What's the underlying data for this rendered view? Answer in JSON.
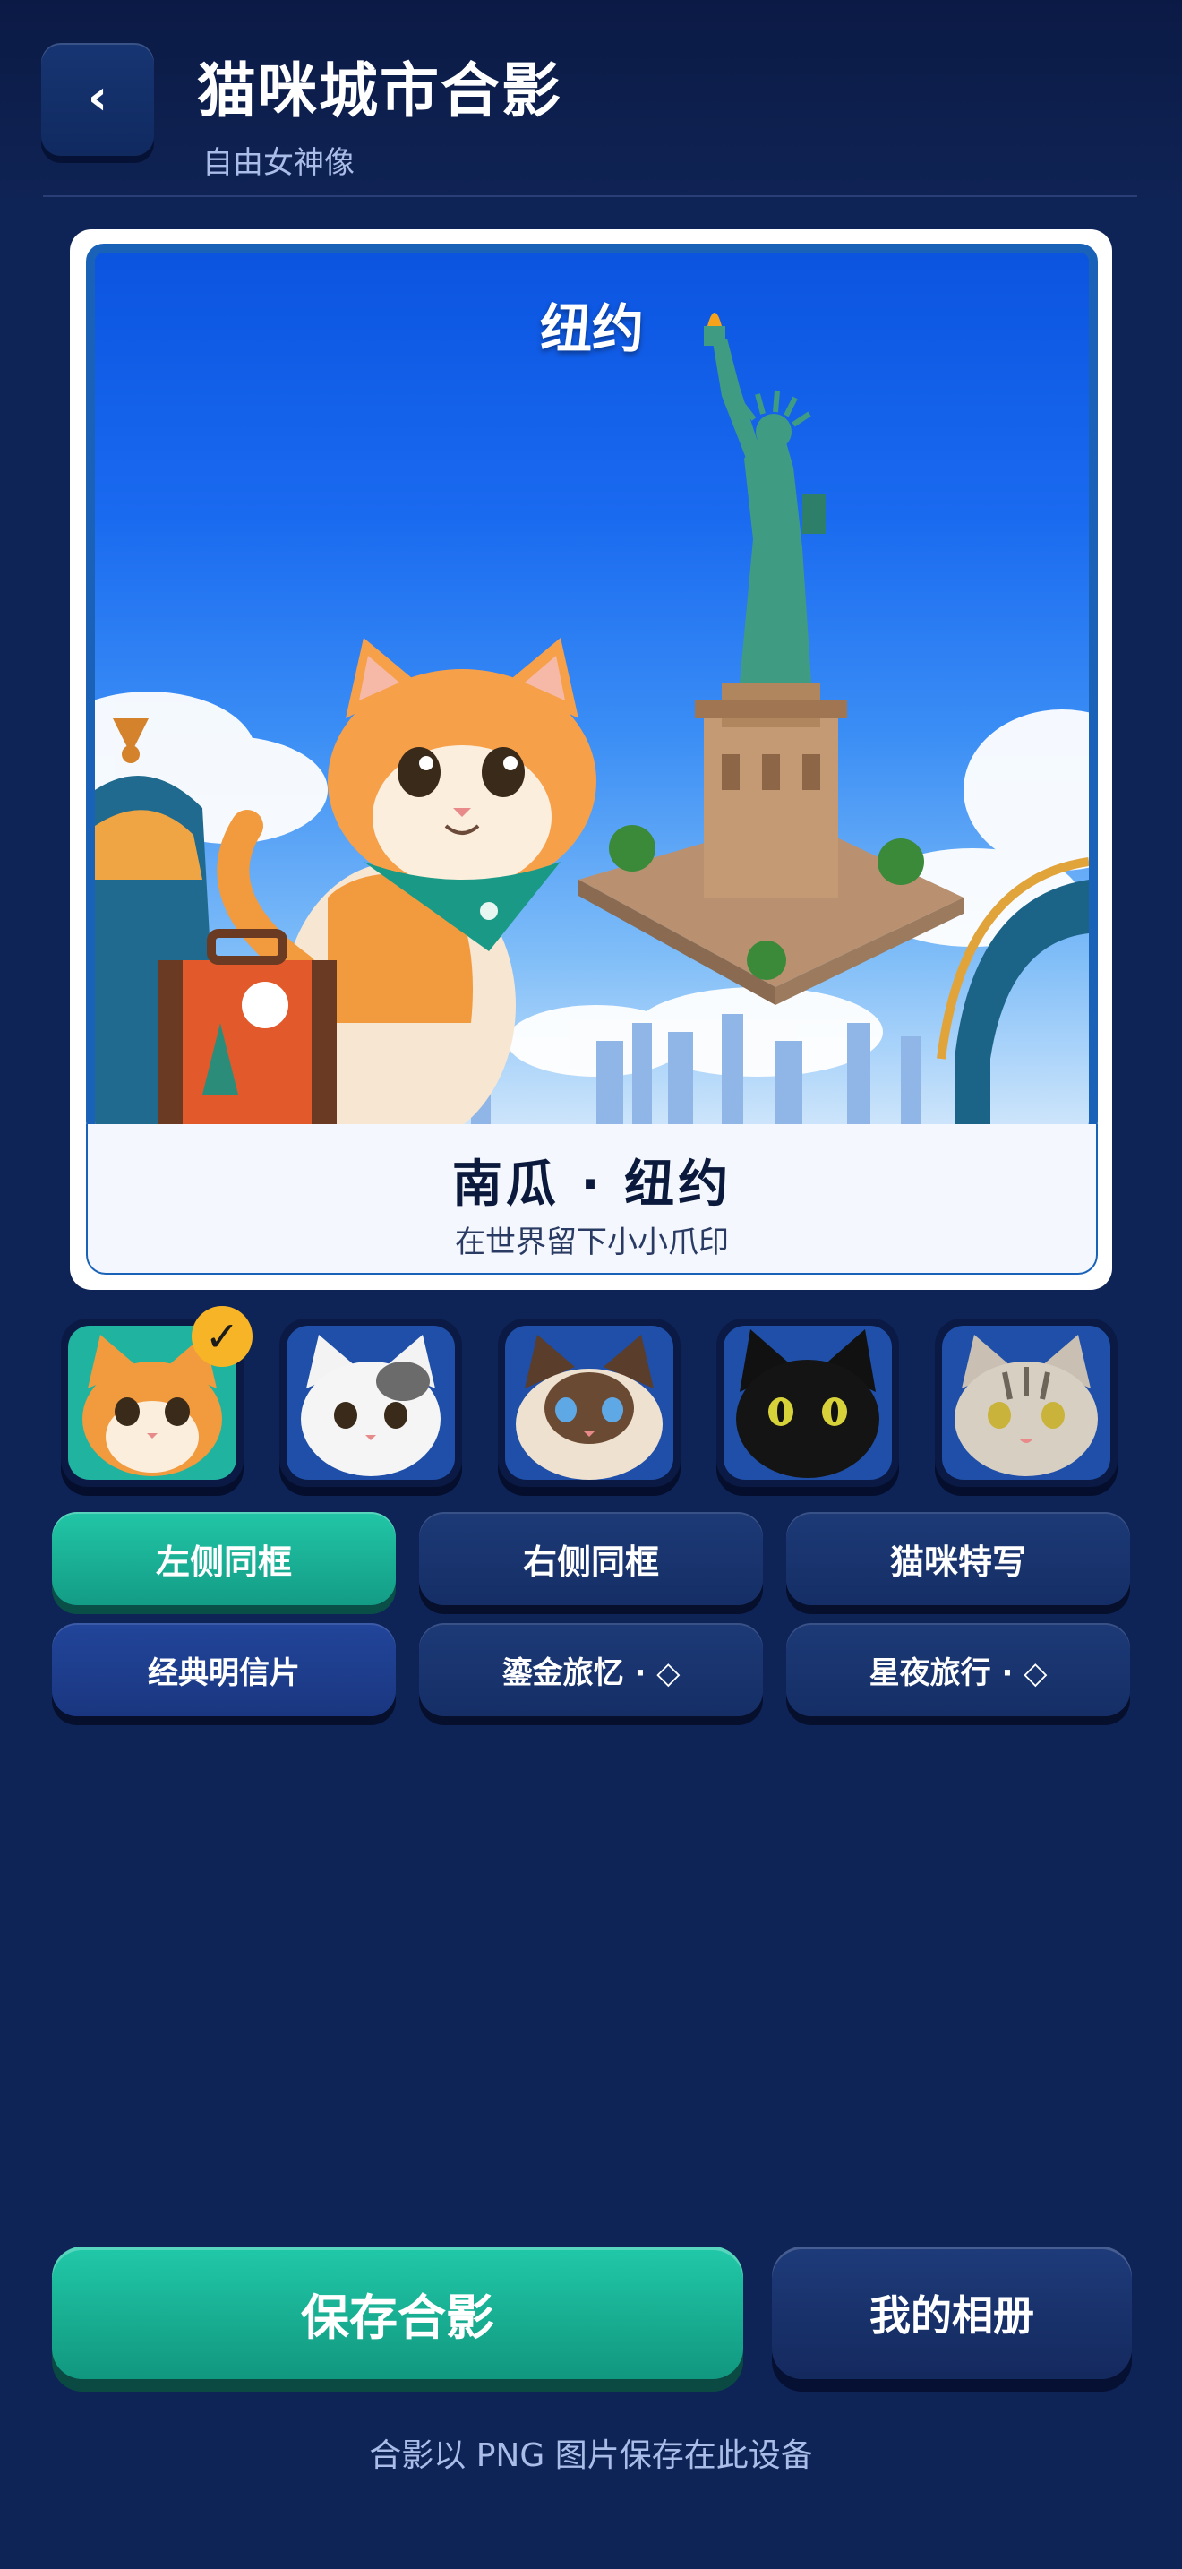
{
  "header": {
    "back_label": "‹",
    "title": "猫咪城市合影",
    "subtitle": "自由女神像"
  },
  "photo": {
    "city": "纽约",
    "caption_title": "南瓜 · 纽约",
    "caption_subtitle": "在世界留下小小爪印"
  },
  "cats": [
    {
      "name": "orange-tabby",
      "selected": true
    },
    {
      "name": "white-calico",
      "selected": false
    },
    {
      "name": "ragdoll",
      "selected": false
    },
    {
      "name": "black-cat",
      "selected": false
    },
    {
      "name": "silver-tabby",
      "selected": false
    }
  ],
  "check_mark": "✓",
  "layouts": [
    {
      "label": "左侧同框",
      "active": true
    },
    {
      "label": "右侧同框",
      "active": false
    },
    {
      "label": "猫咪特写",
      "active": false
    }
  ],
  "themes": [
    {
      "label": "经典明信片"
    },
    {
      "label": "鎏金旅忆 · ◇"
    },
    {
      "label": "星夜旅行 · ◇"
    }
  ],
  "actions": {
    "save_label": "保存合影",
    "album_label": "我的相册",
    "footnote": "合影以 PNG 图片保存在此设备"
  },
  "colors": {
    "background": "#0e2356",
    "accent_teal": "#1bb89b",
    "badge_yellow": "#f6b426"
  }
}
